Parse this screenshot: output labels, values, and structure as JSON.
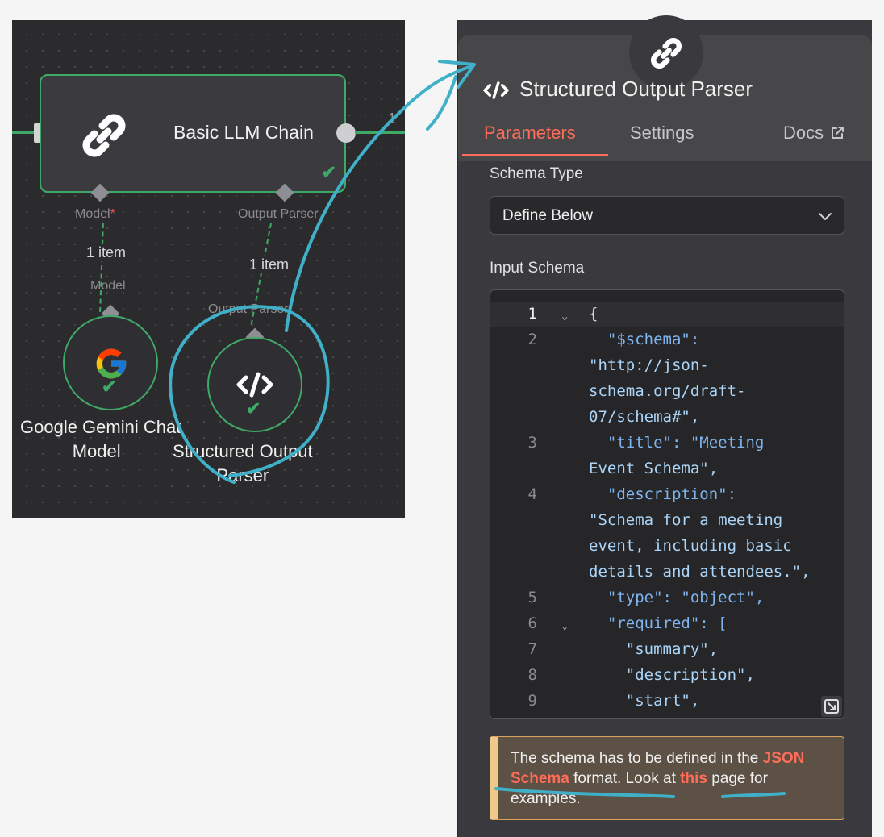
{
  "canvas": {
    "chain_node": {
      "title": "Basic LLM Chain",
      "output_count": "1"
    },
    "ports": {
      "model_label": "Model",
      "model_required": "*",
      "output_parser_label": "Output Parser"
    },
    "connections": {
      "model_count": "1 item",
      "output_parser_count": "1 item"
    },
    "model_node": {
      "port_label": "Model",
      "name_line1": "Google Gemini Chat",
      "name_line2": "Model"
    },
    "parser_node": {
      "port_label": "Output Parser",
      "name_line1": "Structured Output",
      "name_line2": "Parser"
    }
  },
  "panel": {
    "title": "Structured Output Parser",
    "tabs": [
      {
        "label": "Parameters",
        "active": true
      },
      {
        "label": "Settings",
        "active": false
      },
      {
        "label": "Docs",
        "active": false
      }
    ],
    "schema_type": {
      "label": "Schema Type",
      "value": "Define Below"
    },
    "input_schema": {
      "label": "Input Schema",
      "line_numbers": [
        "1",
        "2",
        "3",
        "4",
        "5",
        "6",
        "7",
        "8",
        "9"
      ],
      "lines": [
        "{",
        "  \"$schema\":",
        "\"http://json-",
        "schema.org/draft-",
        "07/schema#\",",
        "  \"title\": \"Meeting",
        "Event Schema\",",
        "  \"description\":",
        "\"Schema for a meeting",
        "event, including basic",
        "details and attendees.\",",
        "  \"type\": \"object\",",
        "  \"required\": [",
        "    \"summary\",",
        "    \"description\",",
        "    \"start\","
      ]
    },
    "notice": {
      "text_1": "The schema has to be defined in the",
      "link_1": "JSON Schema",
      "text_2": " format. Look at ",
      "link_2": "this",
      "text_3": " page for examples."
    }
  },
  "colors": {
    "accent": "#ff6d5a",
    "success": "#3fa967",
    "annotation": "#3fb0c8",
    "canvas_bg": "#2b2b2d",
    "panel_bg": "#3a3a3e"
  },
  "icons": [
    "link-icon",
    "google-g-icon",
    "code-icon",
    "checkmark-icon",
    "chevron-down-icon",
    "external-link-icon",
    "resize-icon"
  ]
}
